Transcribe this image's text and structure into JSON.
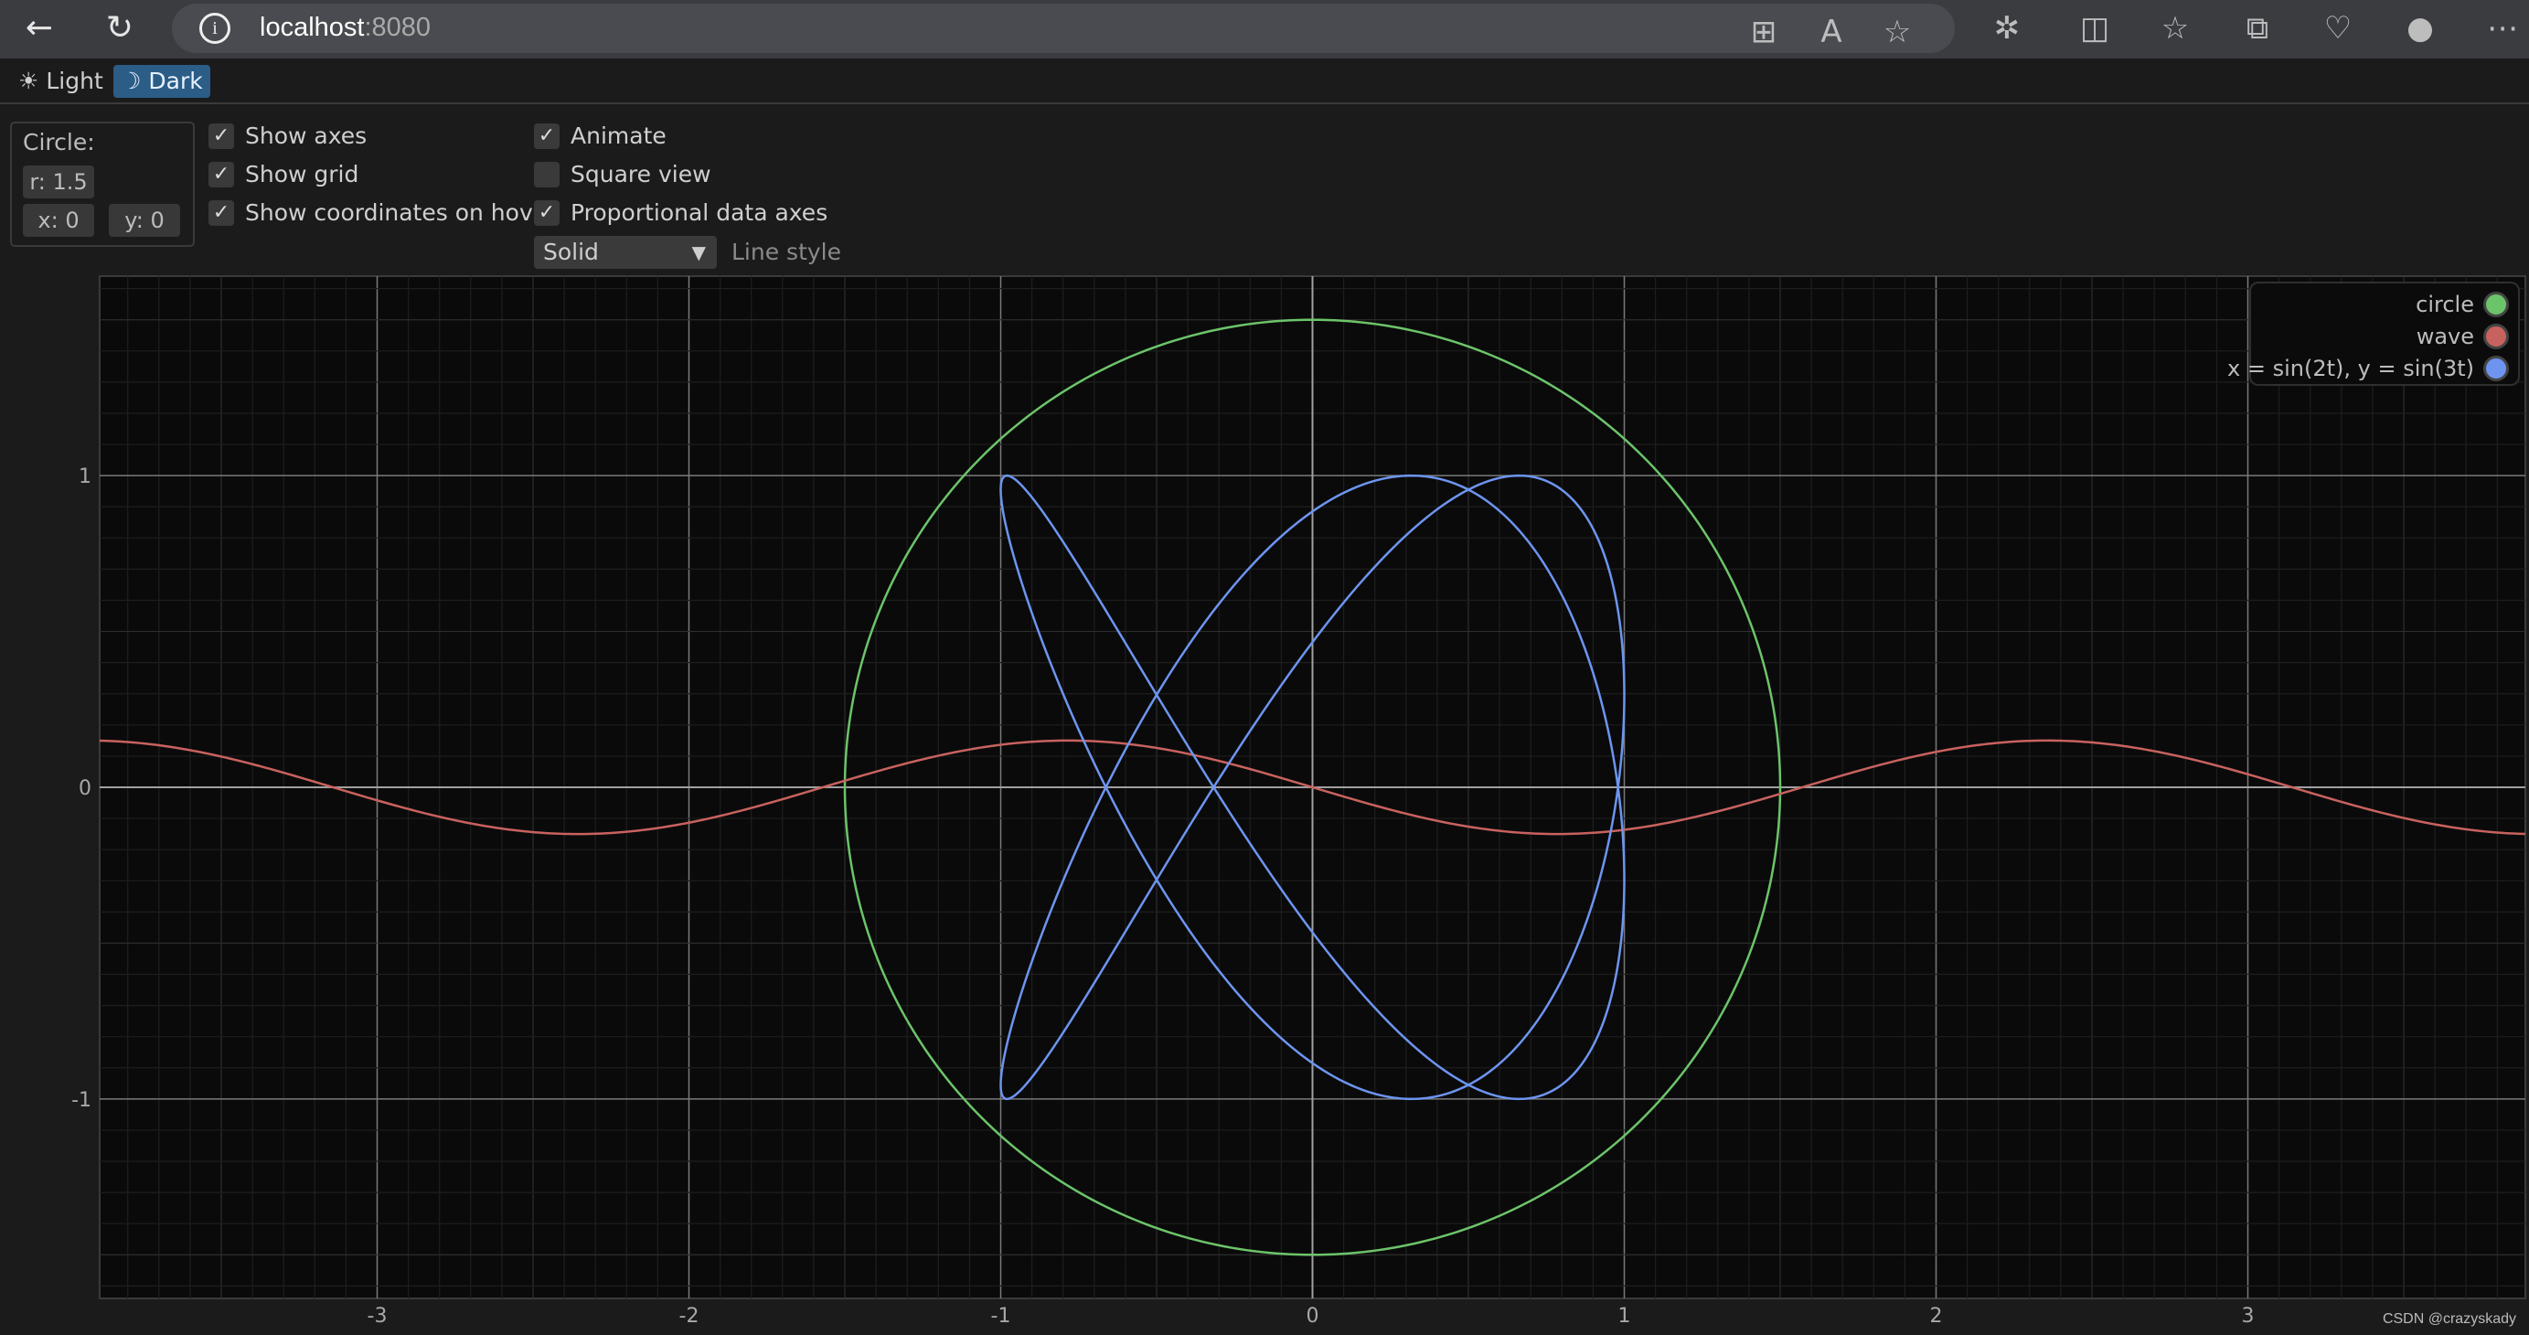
{
  "browser": {
    "url_host": "localhost",
    "url_port": ":8080",
    "icons": [
      "back-arrow-icon",
      "reload-icon",
      "info-icon",
      "apps-icon",
      "read-aloud-icon",
      "favorite-star-icon",
      "extensions-icon",
      "split-screen-icon",
      "favorites-icon",
      "collections-icon",
      "browser-essentials-icon",
      "profile-avatar-icon",
      "more-menu-icon"
    ]
  },
  "theme": {
    "light_label": "Light",
    "dark_label": "Dark",
    "light_icon": "☀",
    "dark_icon": "☽",
    "selected": "Dark"
  },
  "controls": {
    "circle_title": "Circle:",
    "radius": "r: 1.5",
    "x": "x: 0",
    "y": "y: 0",
    "checkboxes": [
      {
        "label": "Show axes",
        "checked": true
      },
      {
        "label": "Show grid",
        "checked": true
      },
      {
        "label": "Show coordinates on hover",
        "checked": true
      },
      {
        "label": "Animate",
        "checked": true
      },
      {
        "label": "Square view",
        "checked": false
      },
      {
        "label": "Proportional data axes",
        "checked": true
      }
    ],
    "line_style_value": "Solid",
    "line_style_label": "Line style"
  },
  "chart_data": {
    "type": "line",
    "xlim": [
      -3.89,
      3.89
    ],
    "ylim": [
      -1.64,
      1.64
    ],
    "grid": true,
    "x_ticks": [
      "-3",
      "-2",
      "-1",
      "0",
      "1",
      "2",
      "3"
    ],
    "y_ticks": [
      "1",
      "0",
      "-1"
    ],
    "legend_position": "top-right",
    "series": [
      {
        "name": "circle",
        "color": "#6cc46a",
        "kind": "circle",
        "radius": 1.5,
        "center": [
          0,
          0
        ]
      },
      {
        "name": "wave",
        "color": "#c8625f",
        "kind": "function",
        "amplitude": 0.15
      },
      {
        "name": "x = sin(2t), y = sin(3t)",
        "color": "#6d95f0",
        "kind": "parametric"
      }
    ]
  },
  "watermark": "CSDN @crazyskady"
}
